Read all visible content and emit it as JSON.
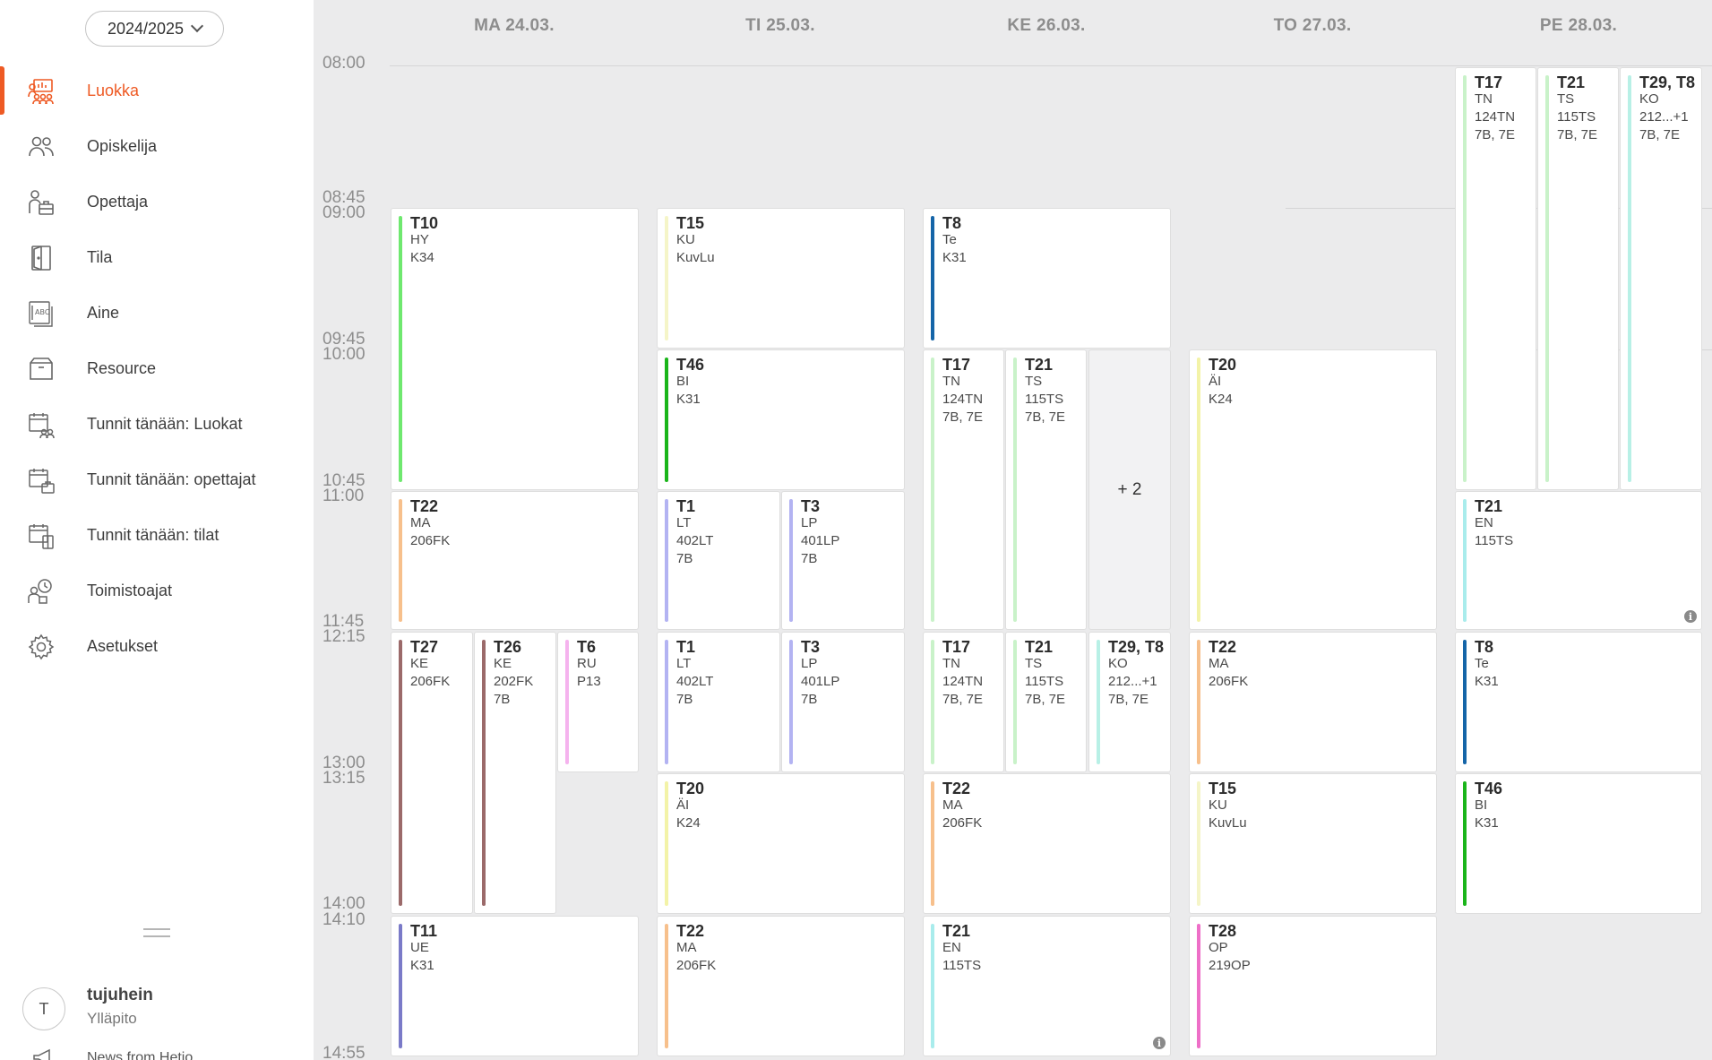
{
  "year_select": {
    "value": "2024/2025"
  },
  "nav": [
    {
      "label": "Luokka",
      "icon": "class-icon",
      "active": true
    },
    {
      "label": "Opiskelija",
      "icon": "students-icon"
    },
    {
      "label": "Opettaja",
      "icon": "teacher-icon"
    },
    {
      "label": "Tila",
      "icon": "door-icon"
    },
    {
      "label": "Aine",
      "icon": "subject-icon"
    },
    {
      "label": "Resource",
      "icon": "box-icon"
    },
    {
      "label": "Tunnit tänään: Luokat",
      "icon": "calendar-group-icon"
    },
    {
      "label": "Tunnit tänään: opettajat",
      "icon": "calendar-teacher-icon"
    },
    {
      "label": "Tunnit tänään: tilat",
      "icon": "calendar-room-icon"
    },
    {
      "label": "Toimistoajat",
      "icon": "office-hours-icon"
    },
    {
      "label": "Asetukset",
      "icon": "gear-icon"
    }
  ],
  "user": {
    "initial": "T",
    "name": "tujuhein",
    "role": "Ylläpito"
  },
  "news_label": "News from Hetio",
  "days": [
    "MA 24.03.",
    "TI 25.03.",
    "KE 26.03.",
    "TO 27.03.",
    "PE 28.03."
  ],
  "times": [
    "08:00",
    "08:45",
    "09:00",
    "09:45",
    "10:00",
    "10:45",
    "11:00",
    "11:45",
    "12:15",
    "13:00",
    "13:15",
    "14:00",
    "14:10",
    "14:55"
  ],
  "colors": {
    "accent": "#ee5a24",
    "green": "#6fe86f",
    "dark_green": "#1bb51b",
    "light_green": "#c9f2c9",
    "mint": "#b8f0e6",
    "cyan": "#a9ecec",
    "blue": "#1565a8",
    "yellow": "#f3f3a8",
    "light_yellow": "#f5f5c8",
    "orange": "#f7c08c",
    "brown": "#9b6a6a",
    "pink": "#f5b3ee",
    "magenta": "#ee6fc8",
    "lavender": "#b3b3f2",
    "slate": "#7a7ac8"
  },
  "lessons": [
    {
      "id": "mon-t10",
      "code": "T10",
      "subject": "HY",
      "room": "K34",
      "group": "",
      "color": "#6fe86f"
    },
    {
      "id": "mon-t22",
      "code": "T22",
      "subject": "MA",
      "room": "206FK",
      "group": "",
      "color": "#f7c08c"
    },
    {
      "id": "mon-t27",
      "code": "T27",
      "subject": "KE",
      "room": "206FK",
      "group": "",
      "color": "#9b6a6a"
    },
    {
      "id": "mon-t26",
      "code": "T26",
      "subject": "KE",
      "room": "202FK",
      "group": "7B",
      "color": "#9b6a6a"
    },
    {
      "id": "mon-t6",
      "code": "T6",
      "subject": "RU",
      "room": "P13",
      "group": "",
      "color": "#f5b3ee"
    },
    {
      "id": "mon-t11",
      "code": "T11",
      "subject": "UE",
      "room": "K31",
      "group": "",
      "color": "#7a7ac8"
    },
    {
      "id": "tue-t15",
      "code": "T15",
      "subject": "KU",
      "room": "KuvLu",
      "group": "",
      "color": "#f5f5c8"
    },
    {
      "id": "tue-t46",
      "code": "T46",
      "subject": "BI",
      "room": "K31",
      "group": "",
      "color": "#1bb51b"
    },
    {
      "id": "tue-t1a",
      "code": "T1",
      "subject": "LT",
      "room": "402LT",
      "group": "7B",
      "color": "#b3b3f2"
    },
    {
      "id": "tue-t3a",
      "code": "T3",
      "subject": "LP",
      "room": "401LP",
      "group": "7B",
      "color": "#b3b3f2"
    },
    {
      "id": "tue-t1b",
      "code": "T1",
      "subject": "LT",
      "room": "402LT",
      "group": "7B",
      "color": "#b3b3f2"
    },
    {
      "id": "tue-t3b",
      "code": "T3",
      "subject": "LP",
      "room": "401LP",
      "group": "7B",
      "color": "#b3b3f2"
    },
    {
      "id": "tue-t20",
      "code": "T20",
      "subject": "ÄI",
      "room": "K24",
      "group": "",
      "color": "#f3f3a8"
    },
    {
      "id": "tue-t22",
      "code": "T22",
      "subject": "MA",
      "room": "206FK",
      "group": "",
      "color": "#f7c08c"
    },
    {
      "id": "wed-t8",
      "code": "T8",
      "subject": "Te",
      "room": "K31",
      "group": "",
      "color": "#1565a8"
    },
    {
      "id": "wed-t17a",
      "code": "T17",
      "subject": "TN",
      "room": "124TN",
      "group": "7B, 7E",
      "color": "#c9f2c9"
    },
    {
      "id": "wed-t21a",
      "code": "T21",
      "subject": "TS",
      "room": "115TS",
      "group": "7B, 7E",
      "color": "#c9f2c9"
    },
    {
      "id": "wed-more",
      "code": "+ 2"
    },
    {
      "id": "wed-t17b",
      "code": "T17",
      "subject": "TN",
      "room": "124TN",
      "group": "7B, 7E",
      "color": "#c9f2c9"
    },
    {
      "id": "wed-t21b",
      "code": "T21",
      "subject": "TS",
      "room": "115TS",
      "group": "7B, 7E",
      "color": "#c9f2c9"
    },
    {
      "id": "wed-t29",
      "code": "T29, T8",
      "subject": "KO",
      "room": "212...+1",
      "group": "7B, 7E",
      "color": "#b8f0e6"
    },
    {
      "id": "wed-t22",
      "code": "T22",
      "subject": "MA",
      "room": "206FK",
      "group": "",
      "color": "#f7c08c"
    },
    {
      "id": "wed-t21c",
      "code": "T21",
      "subject": "EN",
      "room": "115TS",
      "group": "",
      "color": "#a9ecec"
    },
    {
      "id": "thu-t20",
      "code": "T20",
      "subject": "ÄI",
      "room": "K24",
      "group": "",
      "color": "#f3f3a8"
    },
    {
      "id": "thu-t22",
      "code": "T22",
      "subject": "MA",
      "room": "206FK",
      "group": "",
      "color": "#f7c08c"
    },
    {
      "id": "thu-t15",
      "code": "T15",
      "subject": "KU",
      "room": "KuvLu",
      "group": "",
      "color": "#f5f5c8"
    },
    {
      "id": "thu-t28",
      "code": "T28",
      "subject": "OP",
      "room": "219OP",
      "group": "",
      "color": "#ee6fc8"
    },
    {
      "id": "fri-t17",
      "code": "T17",
      "subject": "TN",
      "room": "124TN",
      "group": "7B, 7E",
      "color": "#c9f2c9"
    },
    {
      "id": "fri-t21a",
      "code": "T21",
      "subject": "TS",
      "room": "115TS",
      "group": "7B, 7E",
      "color": "#c9f2c9"
    },
    {
      "id": "fri-t29",
      "code": "T29, T8",
      "subject": "KO",
      "room": "212...+1",
      "group": "7B, 7E",
      "color": "#b8f0e6"
    },
    {
      "id": "fri-t21b",
      "code": "T21",
      "subject": "EN",
      "room": "115TS",
      "group": "",
      "color": "#a9ecec"
    },
    {
      "id": "fri-t8",
      "code": "T8",
      "subject": "Te",
      "room": "K31",
      "group": "",
      "color": "#1565a8"
    },
    {
      "id": "fri-t46",
      "code": "T46",
      "subject": "BI",
      "room": "K31",
      "group": "",
      "color": "#1bb51b"
    }
  ]
}
